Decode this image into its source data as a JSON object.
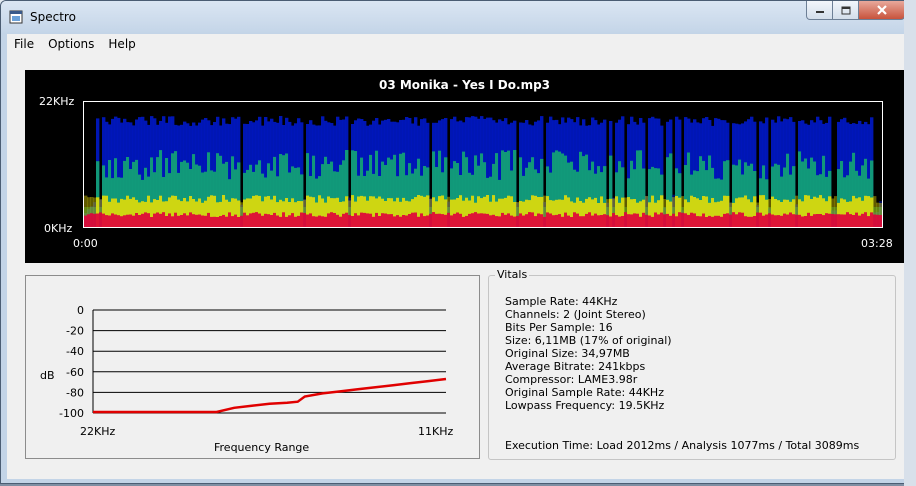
{
  "window": {
    "title": "Spectro",
    "buttons": {
      "minimize": "minimize-icon",
      "maximize": "maximize-icon",
      "close": "close-icon"
    }
  },
  "menu": [
    "File",
    "Options",
    "Help"
  ],
  "spectrogram": {
    "file_title": "03 Monika - Yes I Do.mp3",
    "y_top_label": "22KHz",
    "y_bottom_label": "0KHz",
    "x_start_label": "0:00",
    "x_end_label": "03:28"
  },
  "db_chart": {
    "y_label": "dB",
    "x_label": "Frequency Range",
    "x_tick_left": "22KHz",
    "x_tick_right": "11KHz",
    "y_ticks": [
      "0",
      "-20",
      "-40",
      "-60",
      "-80",
      "-100"
    ]
  },
  "chart_data": {
    "type": "line",
    "xlabel": "Frequency Range",
    "ylabel": "dB",
    "ylim": [
      -100,
      0
    ],
    "x_tick_labels": [
      "22KHz",
      "11KHz"
    ],
    "grid": true,
    "series": [
      {
        "color": "#e00000",
        "x": [
          0,
          0.1,
          0.2,
          0.3,
          0.35,
          0.4,
          0.45,
          0.5,
          0.55,
          0.58,
          0.6,
          0.65,
          0.7,
          0.75,
          0.8,
          0.85,
          0.9,
          0.95,
          1.0
        ],
        "values": [
          -99,
          -99,
          -99,
          -99,
          -99,
          -95,
          -93,
          -91,
          -90,
          -89,
          -84,
          -81,
          -79,
          -77,
          -75,
          -73,
          -71,
          -69,
          -67
        ]
      }
    ]
  },
  "vitals": {
    "legend": "Vitals",
    "lines": [
      "Sample Rate: 44KHz",
      "Channels: 2 (Joint Stereo)",
      "Bits Per Sample: 16",
      "Size: 6,11MB (17% of original)",
      "Original Size: 34,97MB",
      "Average Bitrate: 241kbps",
      "Compressor: LAME3.98r",
      "Original Sample Rate: 44KHz",
      "Lowpass Frequency: 19.5KHz"
    ],
    "execution": "Execution Time: Load 2012ms / Analysis 1077ms / Total 3089ms"
  },
  "colors": {
    "spectrogram_low": "#e0003c",
    "spectrogram_mid": "#f0e000",
    "spectrogram_green": "#18d060",
    "spectrogram_high": "#0018c8",
    "curve": "#e00000"
  }
}
